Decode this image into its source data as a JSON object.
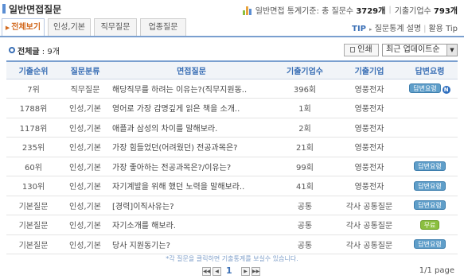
{
  "header": {
    "title": "일반면접질문",
    "stats_label": "일반면접 통계기준:",
    "total_questions_label": "총 질문수",
    "total_questions": "3729개",
    "total_companies_label": "기출기업수",
    "total_companies": "793개",
    "separator": "|"
  },
  "tabs": [
    {
      "label": "전체보기",
      "active": true
    },
    {
      "label": "인성,기본",
      "active": false
    },
    {
      "label": "직무질문",
      "active": false
    },
    {
      "label": "업종질문",
      "active": false
    }
  ],
  "tip": {
    "label": "TIP",
    "link1": "질문통계 설명",
    "separator": "|",
    "link2": "활용 Tip"
  },
  "list_info": {
    "count_label": "전체글",
    "count_value": " : 9개"
  },
  "toolbar": {
    "print_label": "인쇄",
    "sort_selected": "최근 업데이트순"
  },
  "table": {
    "columns": [
      "기출순위",
      "질문분류",
      "면접질문",
      "기출기업수",
      "기출기업",
      "답변요령"
    ],
    "rows": [
      {
        "rank": "7위",
        "category": "직무질문",
        "question": "해당직무를 하려는 이유는?(직무지원동..",
        "count": "396회",
        "company": "영풍전자",
        "answer": "답변요령",
        "answer_style": "blue",
        "is_new": true
      },
      {
        "rank": "1788위",
        "category": "인성,기본",
        "question": "영어로 가장 감명깊게 읽은 책을 소개..",
        "count": "1회",
        "company": "영풍전자",
        "answer": "",
        "answer_style": "",
        "is_new": false
      },
      {
        "rank": "1178위",
        "category": "인성,기본",
        "question": "애플과 삼성의 차이를 말해보라.",
        "count": "2회",
        "company": "영풍전자",
        "answer": "",
        "answer_style": "",
        "is_new": false
      },
      {
        "rank": "235위",
        "category": "인성,기본",
        "question": "가장 힘들었던(어려웠던) 전공과목은?",
        "count": "21회",
        "company": "영풍전자",
        "answer": "",
        "answer_style": "",
        "is_new": false
      },
      {
        "rank": "60위",
        "category": "인성,기본",
        "question": "가장 좋아하는 전공과목은?/이유는?",
        "count": "99회",
        "company": "영풍전자",
        "answer": "답변요령",
        "answer_style": "blue",
        "is_new": false
      },
      {
        "rank": "130위",
        "category": "인성,기본",
        "question": "자기계발을 위해 했던 노력을 말해보라..",
        "count": "41회",
        "company": "영풍전자",
        "answer": "답변요령",
        "answer_style": "blue",
        "is_new": false
      },
      {
        "rank": "기본질문",
        "category": "인성,기본",
        "question": "[경력]이직사유는?",
        "count": "공통",
        "company": "각사 공통질문",
        "answer": "답변요령",
        "answer_style": "blue",
        "is_new": false
      },
      {
        "rank": "기본질문",
        "category": "인성,기본",
        "question": "자기소개를 해보라.",
        "count": "공통",
        "company": "각사 공통질문",
        "answer": "무료",
        "answer_style": "green",
        "is_new": false
      },
      {
        "rank": "기본질문",
        "category": "인성,기본",
        "question": "당사 지원동기는?",
        "count": "공통",
        "company": "각사 공통질문",
        "answer": "답변요령",
        "answer_style": "blue",
        "is_new": false
      }
    ]
  },
  "footnote": "*각 질문을 클릭하면 기출통계를 보실수 있습니다.",
  "pagination": {
    "current_page": "1",
    "total": "1/1 page"
  },
  "colors": {
    "accent": "#3a6fb5",
    "active_tab": "#d2691e",
    "badge_blue": "#5f9ec9",
    "badge_green": "#8bbf3f",
    "header_bg": "#f1f4f8"
  }
}
